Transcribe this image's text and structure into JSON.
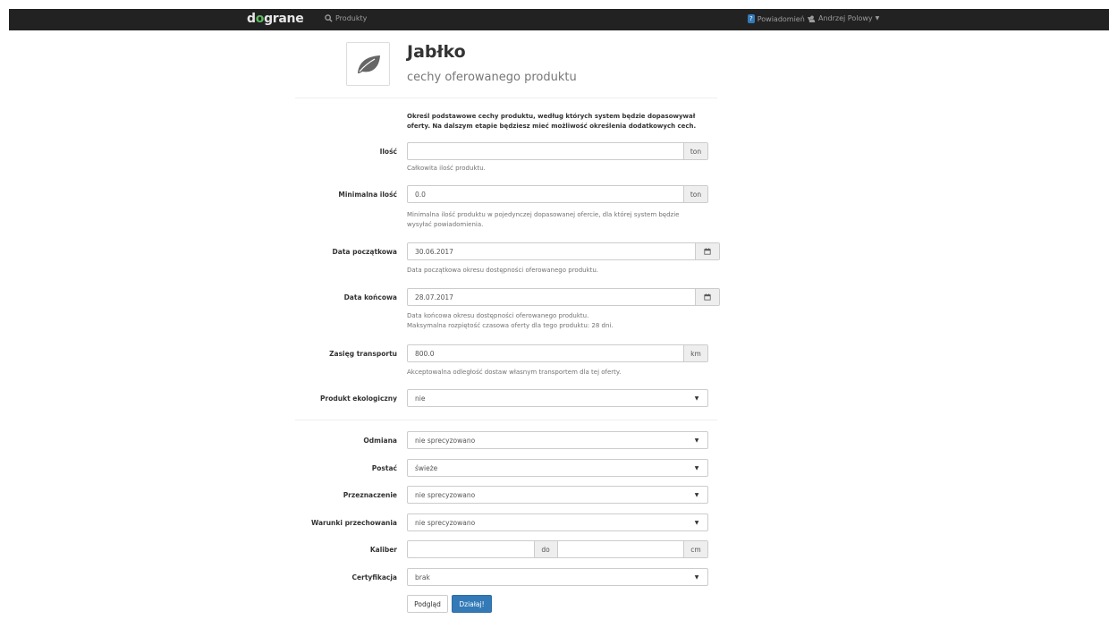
{
  "navbar": {
    "brand_pre": "d",
    "brand_o": "o",
    "brand_post": "grane",
    "products_label": "Produkty",
    "notif_count": "?",
    "notif_label": "Powiadomień",
    "user_name": "Andrzej Polowy"
  },
  "header": {
    "title": "Jabłko",
    "subtitle": "cechy oferowanego produktu"
  },
  "intro": "Określ podstawowe cechy produktu, według których system będzie dopasowywał oferty. Na dalszym etapie będziesz mieć możliwość określenia dodatkowych cech.",
  "fields": {
    "ilosc": {
      "label": "Ilość",
      "value": "",
      "unit": "ton",
      "help": "Całkowita ilość produktu."
    },
    "min_ilosc": {
      "label": "Minimalna ilość",
      "value": "0.0",
      "unit": "ton",
      "help1": "Minimalna ilość produktu w pojedynczej dopasowanej ofercie, dla której system będzie",
      "help2": "wysyłać powiadomienia."
    },
    "data_pocz": {
      "label": "Data początkowa",
      "value": "30.06.2017",
      "help": "Data początkowa okresu dostępności oferowanego produktu."
    },
    "data_konc": {
      "label": "Data końcowa",
      "value": "28.07.2017",
      "help1": "Data końcowa okresu dostępności oferowanego produktu.",
      "help2": "Maksymalna rozpiętość czasowa oferty dla tego produktu: 28 dni."
    },
    "zasieg": {
      "label": "Zasięg transportu",
      "value": "800.0",
      "unit": "km",
      "help": "Akceptowalna odległość dostaw własnym transportem dla tej oferty."
    },
    "eko": {
      "label": "Produkt ekologiczny",
      "value": "nie"
    },
    "odmiana": {
      "label": "Odmiana",
      "value": "nie sprecyzowano"
    },
    "postac": {
      "label": "Postać",
      "value": "świeże"
    },
    "przeznaczenie": {
      "label": "Przeznaczenie",
      "value": "nie sprecyzowano"
    },
    "warunki": {
      "label": "Warunki przechowania",
      "value": "nie sprecyzowano"
    },
    "kaliber": {
      "label": "Kaliber",
      "from": "",
      "sep": "do",
      "to": "",
      "unit": "cm"
    },
    "certyfikacja": {
      "label": "Certyfikacja",
      "value": "brak"
    }
  },
  "buttons": {
    "preview": "Podgląd",
    "submit": "Działaj!"
  },
  "colors": {
    "navbar": "#222222",
    "brand_accent": "#5cb85c",
    "primary": "#337ab7"
  }
}
